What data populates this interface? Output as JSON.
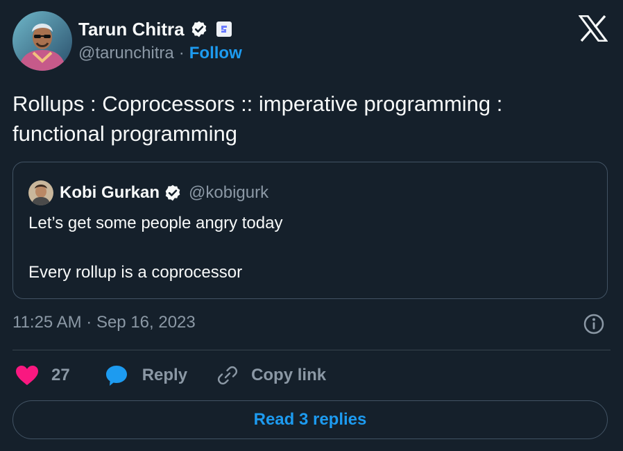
{
  "author": {
    "name": "Tarun Chitra",
    "handle": "@tarunchitra",
    "separator": "·",
    "follow_label": "Follow"
  },
  "tweet": {
    "text_line1": "Rollups : Coprocessors :: imperative programming :",
    "text_line2": "functional programming"
  },
  "quoted": {
    "name": "Kobi Gurkan",
    "handle": "@kobigurk",
    "line1": "Let’s get some people angry today",
    "line2": "Every rollup is a coprocessor"
  },
  "timestamp": "11:25 AM · Sep 16, 2023",
  "actions": {
    "like_count": "27",
    "reply_label": "Reply",
    "copy_label": "Copy link"
  },
  "read_replies_label": "Read 3 replies",
  "colors": {
    "background": "#15202b",
    "accent": "#1d9bf0",
    "like": "#f91880",
    "muted": "#8b98a5"
  },
  "icons": [
    "verified-badge-icon",
    "affiliation-icon",
    "x-logo-icon",
    "info-icon",
    "heart-icon",
    "reply-bubble-icon",
    "link-icon"
  ]
}
